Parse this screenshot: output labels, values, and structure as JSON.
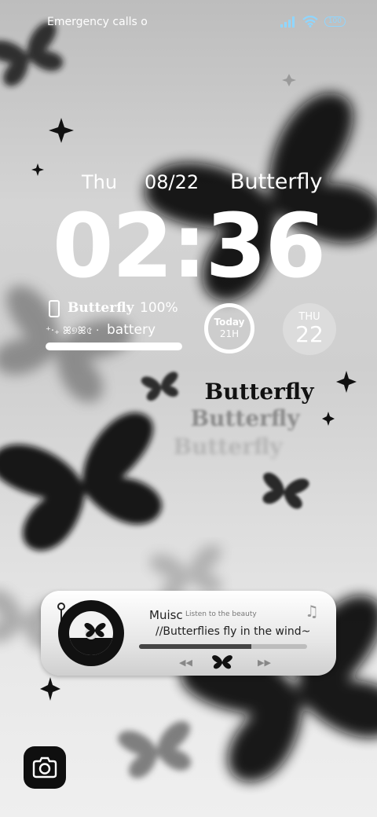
{
  "status_bar": {
    "carrier": "Emergency calls o",
    "battery": "100"
  },
  "lock_date": {
    "weekday": "Thu",
    "date": "08/22",
    "theme": "Butterfly"
  },
  "clock": {
    "time": "02:36"
  },
  "battery_widget": {
    "brand": "Butterfly",
    "percent_text": "100%",
    "decor": "⁺‧₊ ꕤ୭ꕤ৫ ·",
    "label": "battery",
    "level": 1.0
  },
  "today_ring": {
    "label": "Today",
    "value": "21H"
  },
  "day_disc": {
    "weekday": "THU",
    "day": "22"
  },
  "butterfly_titles": [
    "Butterfly",
    "Butterfly",
    "Butterfly"
  ],
  "music": {
    "title": "Muisc",
    "subtitle": "Listen to the beauty",
    "lyric": "//Butterflies fly in the wind~",
    "progress": 0.67,
    "prev_icon": "rewind-icon",
    "play_icon": "butterfly-play-icon",
    "next_icon": "fast-forward-icon",
    "note_icon": "music-note-icon"
  },
  "colors": {
    "text": "#ffffff",
    "wifi": "#8fd6ff",
    "signal": "#8fd6ff",
    "dark": "#111111"
  }
}
